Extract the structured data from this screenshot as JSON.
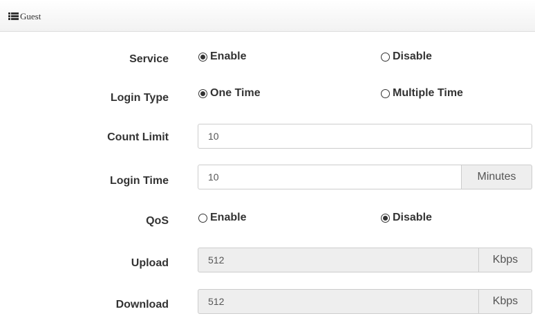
{
  "header": {
    "title": "Guest",
    "icon": "list-icon"
  },
  "service": {
    "label": "Service",
    "options": [
      {
        "label": "Enable",
        "selected": true
      },
      {
        "label": "Disable",
        "selected": false
      }
    ]
  },
  "login_type": {
    "label": "Login Type",
    "options": [
      {
        "label": "One Time",
        "selected": true
      },
      {
        "label": "Multiple Time",
        "selected": false
      }
    ]
  },
  "count_limit": {
    "label": "Count Limit",
    "value": "10"
  },
  "login_time": {
    "label": "Login Time",
    "value": "10",
    "unit": "Minutes"
  },
  "qos": {
    "label": "QoS",
    "options": [
      {
        "label": "Enable",
        "selected": false
      },
      {
        "label": "Disable",
        "selected": true
      }
    ]
  },
  "upload": {
    "label": "Upload",
    "value": "512",
    "unit": "Kbps"
  },
  "download": {
    "label": "Download",
    "value": "512",
    "unit": "Kbps"
  }
}
